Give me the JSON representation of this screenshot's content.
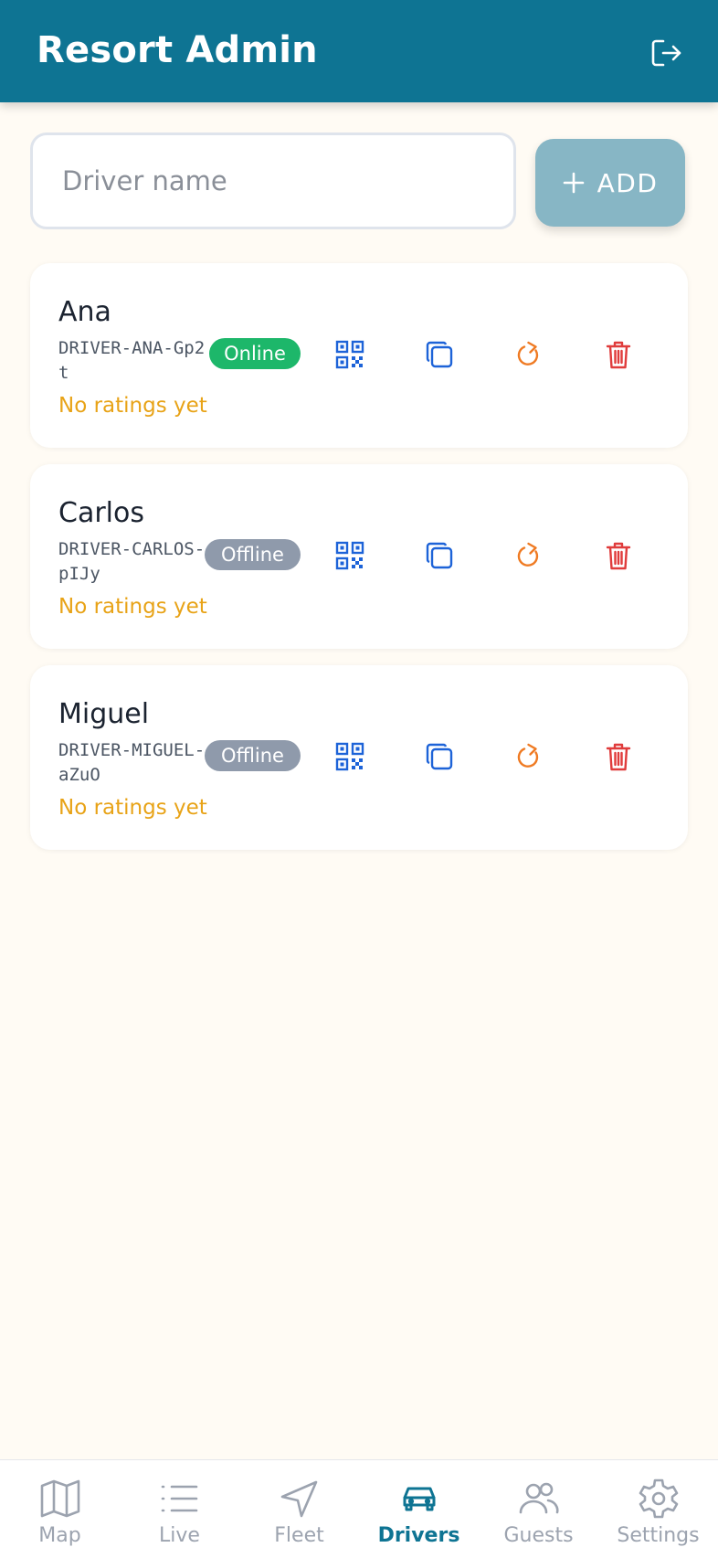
{
  "header": {
    "title": "Resort Admin",
    "logout_icon": "logout-icon"
  },
  "add_driver": {
    "placeholder": "Driver name",
    "value": "",
    "add_label": "ADD",
    "add_icon": "plus-icon"
  },
  "colors": {
    "header": "#0e7493",
    "online": "#1db76a",
    "offline": "#8f9aab",
    "rating": "#e8a317",
    "qr_action": "#1d63d8",
    "copy_action": "#1d63d8",
    "reset_action": "#ef7a22",
    "delete_action": "#e03c3c",
    "nav_active": "#0e7493",
    "nav_inactive": "#9ca3af"
  },
  "drivers": [
    {
      "name": "Ana",
      "code": "DRIVER-ANA-Gp2t",
      "status": "Online",
      "rating": "No ratings yet"
    },
    {
      "name": "Carlos",
      "code": "DRIVER-CARLOS-pIJy",
      "status": "Offline",
      "rating": "No ratings yet"
    },
    {
      "name": "Miguel",
      "code": "DRIVER-MIGUEL-aZuO",
      "status": "Offline",
      "rating": "No ratings yet"
    }
  ],
  "actions": {
    "icons": [
      "qr-code-icon",
      "copy-icon",
      "refresh-icon",
      "trash-icon"
    ]
  },
  "nav": {
    "active": "Drivers",
    "items": [
      {
        "label": "Map",
        "icon": "map-icon"
      },
      {
        "label": "Live",
        "icon": "list-icon"
      },
      {
        "label": "Fleet",
        "icon": "navigation-icon"
      },
      {
        "label": "Drivers",
        "icon": "car-icon"
      },
      {
        "label": "Guests",
        "icon": "users-icon"
      },
      {
        "label": "Settings",
        "icon": "gear-icon"
      }
    ]
  }
}
